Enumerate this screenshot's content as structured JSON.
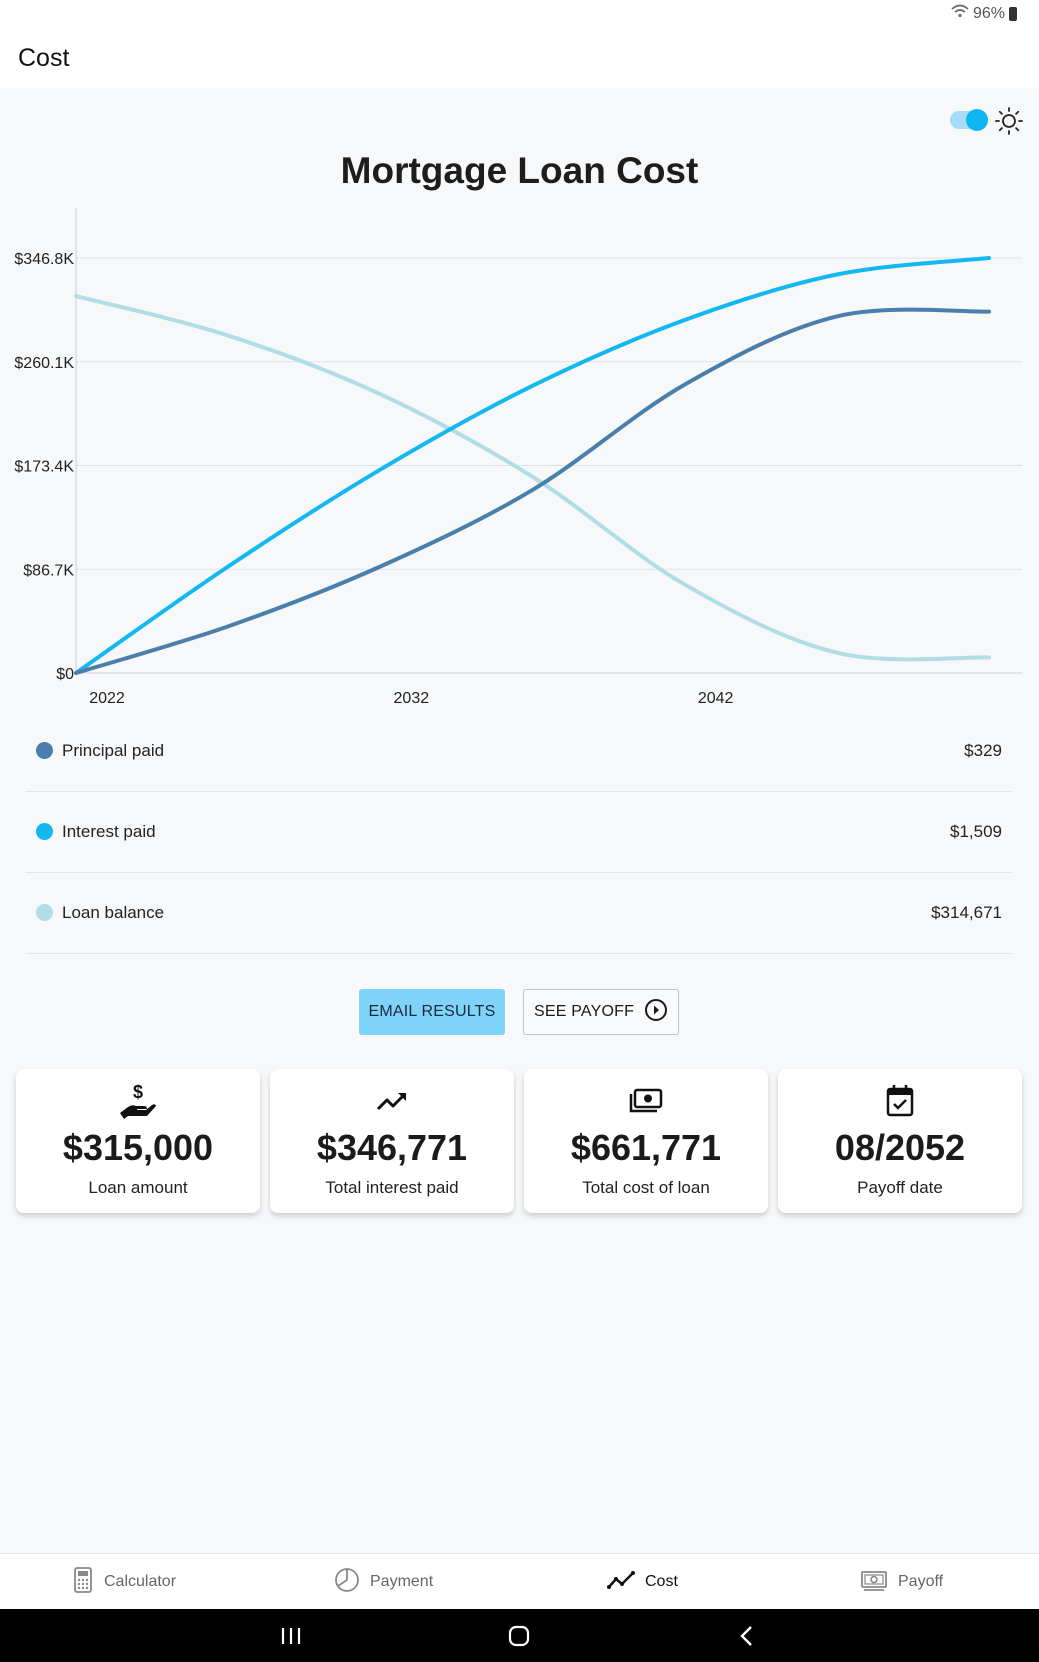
{
  "status": {
    "battery": "96%"
  },
  "appbar": {
    "title": "Cost"
  },
  "chart_data": {
    "type": "line",
    "title": "Mortgage Loan Cost",
    "x": [
      2022,
      2027,
      2032,
      2037,
      2042,
      2047,
      2052
    ],
    "xticks": [
      "2022",
      "2032",
      "2042"
    ],
    "yticks": [
      "$0",
      "$86.7K",
      "$173.4K",
      "$260.1K",
      "$346.8K"
    ],
    "ylim": [
      0,
      346800
    ],
    "series": [
      {
        "name": "Principal paid",
        "color": "#4a7fab",
        "values": [
          0,
          39000,
          89000,
          153000,
          241000,
          298000,
          302000
        ]
      },
      {
        "name": "Interest paid",
        "color": "#12b8ef",
        "values": [
          0,
          89000,
          170000,
          240000,
          295000,
          333000,
          346771
        ]
      },
      {
        "name": "Loan balance",
        "color": "#b0dde6",
        "values": [
          315000,
          282000,
          233000,
          164000,
          74000,
          17000,
          13000
        ]
      }
    ],
    "grid": true
  },
  "legend": [
    {
      "label": "Principal paid",
      "value": "$329",
      "color": "#4a7fab"
    },
    {
      "label": "Interest paid",
      "value": "$1,509",
      "color": "#12b8ef"
    },
    {
      "label": "Loan balance",
      "value": "$314,671",
      "color": "#b0dde6"
    }
  ],
  "buttons": {
    "email": "EMAIL RESULTS",
    "payoff": "SEE PAYOFF"
  },
  "cards": [
    {
      "value": "$315,000",
      "label": "Loan amount",
      "icon": "hand-dollar-icon"
    },
    {
      "value": "$346,771",
      "label": "Total interest paid",
      "icon": "trending-up-icon"
    },
    {
      "value": "$661,771",
      "label": "Total cost of loan",
      "icon": "money-stack-icon"
    },
    {
      "value": "08/2052",
      "label": "Payoff date",
      "icon": "calendar-check-icon"
    }
  ],
  "nav": [
    {
      "label": "Calculator",
      "icon": "calculator-icon"
    },
    {
      "label": "Payment",
      "icon": "pie-chart-icon"
    },
    {
      "label": "Cost",
      "icon": "trend-line-icon",
      "active": true
    },
    {
      "label": "Payoff",
      "icon": "banknote-icon"
    }
  ]
}
